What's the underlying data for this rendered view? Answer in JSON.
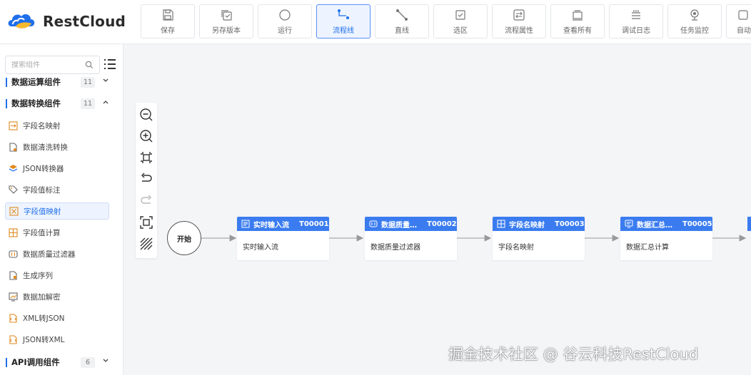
{
  "app": {
    "logo_text": "RestCloud",
    "brand_color": "#1f6feb"
  },
  "toolbar": [
    {
      "label": "保存",
      "icon": "save-icon"
    },
    {
      "label": "另存版本",
      "icon": "copy-version-icon"
    },
    {
      "label": "运行",
      "icon": "run-icon"
    },
    {
      "label": "流程线",
      "icon": "flow-line-icon",
      "active": true
    },
    {
      "label": "直线",
      "icon": "straight-line-icon"
    },
    {
      "label": "选区",
      "icon": "select-area-icon"
    },
    {
      "label": "流程属性",
      "icon": "flow-properties-icon"
    },
    {
      "label": "查看所有",
      "icon": "view-all-icon"
    },
    {
      "label": "调试日志",
      "icon": "debug-log-icon"
    },
    {
      "label": "任务监控",
      "icon": "task-monitor-icon"
    },
    {
      "label": "自动",
      "icon": "auto-icon"
    }
  ],
  "sidebar": {
    "search_placeholder": "搜索组件",
    "groups": [
      {
        "name": "数据运算组件",
        "count": "11",
        "expanded": false
      },
      {
        "name": "数据转换组件",
        "count": "11",
        "expanded": true
      },
      {
        "name": "API调用组件",
        "count": "6",
        "expanded": false
      }
    ],
    "items": [
      {
        "label": "字段名映射",
        "icon": "field-name-mapping-icon"
      },
      {
        "label": "数据清洗转换",
        "icon": "data-cleaning-icon"
      },
      {
        "label": "JSON转换器",
        "icon": "json-converter-icon"
      },
      {
        "label": "字段值标注",
        "icon": "tag-icon"
      },
      {
        "label": "字段值映射",
        "icon": "field-value-mapping-icon",
        "selected": true
      },
      {
        "label": "字段值计算",
        "icon": "calculate-icon"
      },
      {
        "label": "数据质量过滤器",
        "icon": "quality-filter-icon"
      },
      {
        "label": "生成序列",
        "icon": "sequence-icon"
      },
      {
        "label": "数据加解密",
        "icon": "encrypt-icon"
      },
      {
        "label": "XML转JSON",
        "icon": "xml-to-json-icon"
      },
      {
        "label": "JSON转XML",
        "icon": "json-to-xml-icon"
      }
    ]
  },
  "canvas": {
    "start_label": "开始",
    "nodes": [
      {
        "title": "实时输入流",
        "id": "T00001",
        "body": "实时输入流",
        "icon": "stream-icon"
      },
      {
        "title": "数据质量…",
        "id": "T00002",
        "body": "数据质量过滤器",
        "icon": "quality-filter-icon"
      },
      {
        "title": "字段名映射",
        "id": "T00003",
        "body": "字段名映射",
        "icon": "field-name-mapping-icon"
      },
      {
        "title": "数据汇总…",
        "id": "T00005",
        "body": "数据汇总计算",
        "icon": "summary-icon"
      }
    ]
  },
  "watermark": "掘金技术社区 @ 谷云科技RestCloud"
}
